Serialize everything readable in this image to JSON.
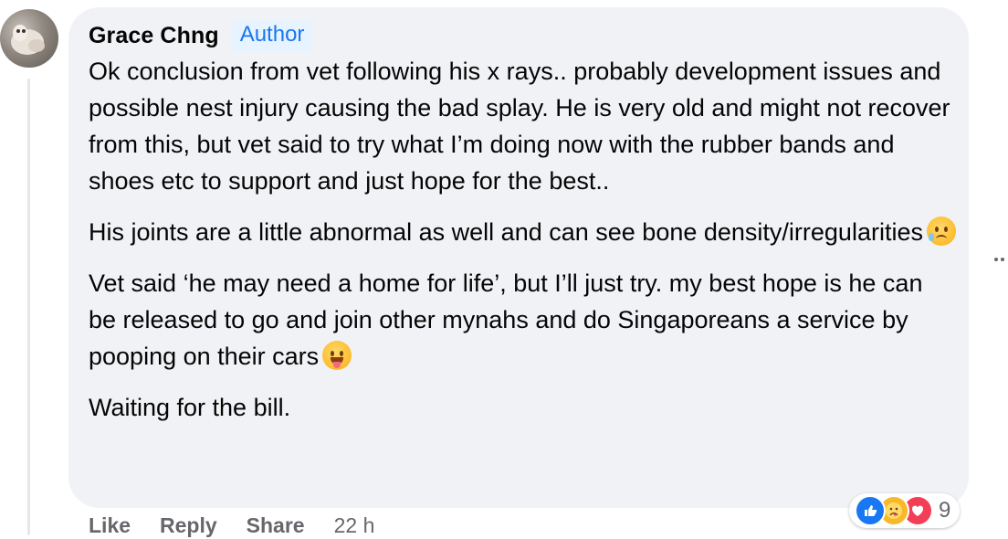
{
  "comment": {
    "author": "Grace Chng",
    "badge": "Author",
    "paragraphs": [
      "Ok conclusion from vet following his x rays.. probably development issues and possible nest injury causing the bad splay. He is very old and might not recover from this, but vet said to try what I’m doing now with the rubber bands and shoes etc to support and just hope for the best..",
      "His joints are a little abnormal as well and can see bone density/irregularities",
      "Vet said ‘he may need a home for life’, but I’ll just try. my best hope is he can be released to go and join other mynahs and do Singaporeans a service by pooping on their cars",
      "Waiting for the bill."
    ],
    "emojis": [
      "sad-but-relieved-face-emoji",
      "zany-face-emoji"
    ]
  },
  "actions": {
    "like": "Like",
    "reply": "Reply",
    "share": "Share",
    "timestamp": "22 h"
  },
  "reactions": {
    "icons": [
      "like-icon",
      "care-icon",
      "love-icon"
    ],
    "count": "9"
  },
  "colors": {
    "bubble": "#f0f2f5",
    "badge_bg": "#e7f3ff",
    "badge_text": "#1877f2",
    "secondary_text": "#65676b"
  }
}
